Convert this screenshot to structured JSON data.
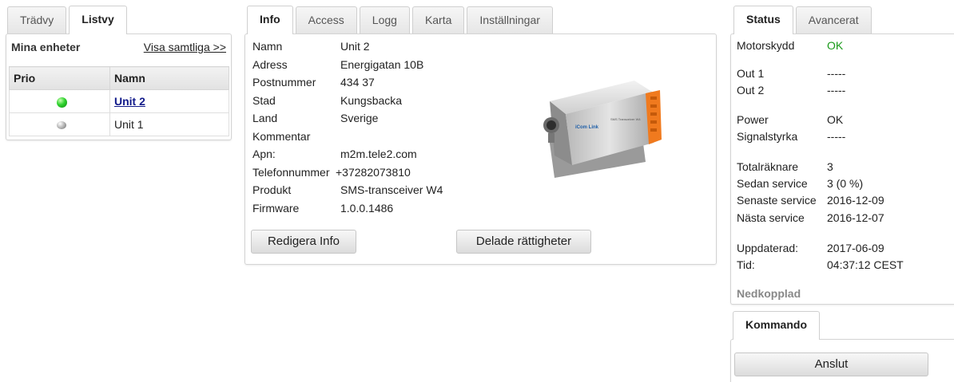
{
  "left": {
    "tabs": [
      {
        "label": "Trädvy",
        "active": false
      },
      {
        "label": "Listvy",
        "active": true
      }
    ],
    "title": "Mina enheter",
    "show_all": "Visa samtliga >>",
    "columns": [
      "Prio",
      "Namn"
    ],
    "units": [
      {
        "prio": "green",
        "name": "Unit 2",
        "selected": true
      },
      {
        "prio": "grey",
        "name": "Unit 1",
        "selected": false
      }
    ]
  },
  "info": {
    "tabs": [
      {
        "label": "Info",
        "active": true
      },
      {
        "label": "Access",
        "active": false
      },
      {
        "label": "Logg",
        "active": false
      },
      {
        "label": "Karta",
        "active": false
      },
      {
        "label": "Inställningar",
        "active": false
      }
    ],
    "fields": [
      {
        "label": "Namn",
        "value": "Unit 2"
      },
      {
        "label": "Adress",
        "value": "Energigatan 10B"
      },
      {
        "label": "Postnummer",
        "value": "434 37"
      },
      {
        "label": "Stad",
        "value": "Kungsbacka"
      },
      {
        "label": "Land",
        "value": "Sverige"
      },
      {
        "label": "Kommentar",
        "value": ""
      },
      {
        "label": "Apn:",
        "value": "m2m.tele2.com"
      },
      {
        "label": "Telefonnummer",
        "value": "+37282073810"
      },
      {
        "label": "Produkt",
        "value": "SMS-transceiver W4"
      },
      {
        "label": "Firmware",
        "value": "1.0.0.1486"
      }
    ],
    "edit_button": "Redigera Info",
    "shared_button": "Delade rättigheter",
    "device_logo": "iCom Link",
    "device_label": "SMS Transceiver W4"
  },
  "status": {
    "tabs": [
      {
        "label": "Status",
        "active": true
      },
      {
        "label": "Avancerat",
        "active": false
      }
    ],
    "motor_label": "Motorskydd",
    "motor_value": "OK",
    "out1_label": "Out 1",
    "out1_value": "-----",
    "out2_label": "Out 2",
    "out2_value": "-----",
    "power_label": "Power",
    "power_value": "OK",
    "signal_label": "Signalstyrka",
    "signal_value": "-----",
    "total_label": "Totalräknare",
    "total_value": "3",
    "since_label": "Sedan service",
    "since_value": "3 (0 %)",
    "last_label": "Senaste service",
    "last_value": "2016-12-09",
    "next_label": "Nästa service",
    "next_value": "2016-12-07",
    "updated_label": "Uppdaterad:",
    "updated_value": "2017-06-09",
    "time_label": "Tid:",
    "time_value": "04:37:12 CEST",
    "connection": "Nedkopplad"
  },
  "command": {
    "tab": "Kommando",
    "connect_button": "Anslut"
  },
  "colors": {
    "ok_green": "#1a9a1a",
    "device_orange": "#f07a1e"
  }
}
